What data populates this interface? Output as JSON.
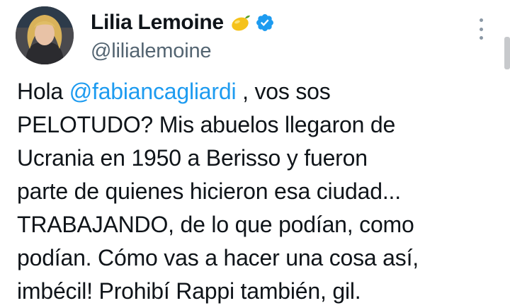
{
  "author": {
    "display_name": "Lilia Lemoine",
    "handle": "@lilialemoine",
    "name_emoji": "lemon",
    "verified": true,
    "avatar": "profile-photo"
  },
  "menu": {
    "icon": "more-vertical-icon"
  },
  "tweet": {
    "greeting": "Hola ",
    "mention": "@fabiancagliardi",
    "text_after_mention": " , vos sos\nPELOTUDO? Mis abuelos llegaron de\nUcrania en 1950 a Berisso y fueron\nparte de quienes hicieron esa ciudad...\nTRABAJANDO, de lo que podían, como\npodían. Cómo vas a hacer una cosa así,\nimbécil! Prohibí Rappi también, gil."
  },
  "colors": {
    "link": "#1d9bf0",
    "verified": "#1d9bf0",
    "handle": "#536471",
    "text": "#0f1419"
  }
}
